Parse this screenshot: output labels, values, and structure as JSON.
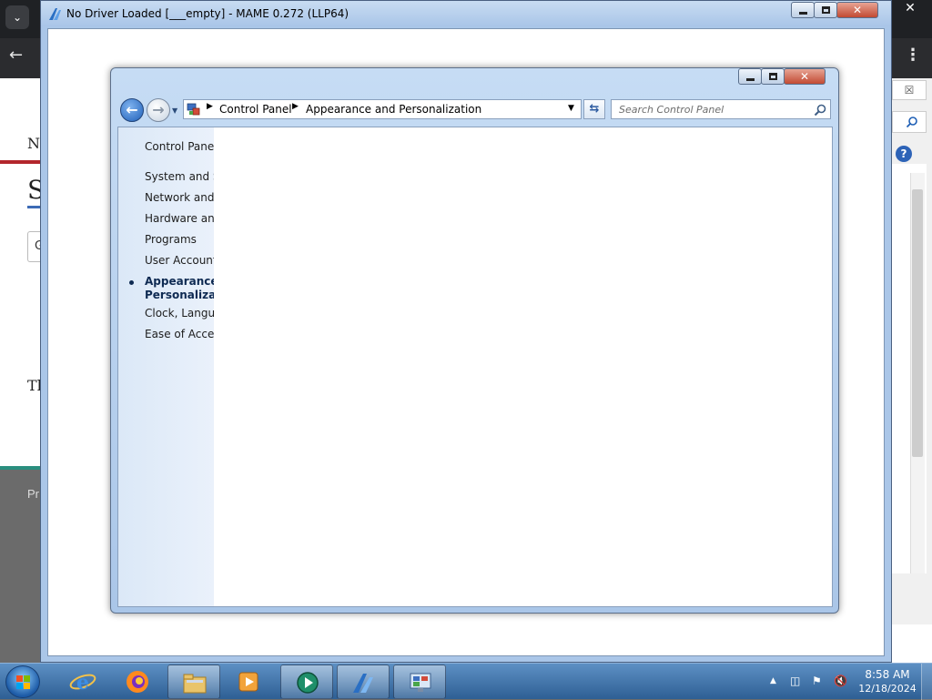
{
  "mame": {
    "title": "No Driver Loaded [___empty] - MAME 0.272 (LLP64)"
  },
  "control_panel": {
    "breadcrumb": [
      "Control Panel",
      "Appearance and Personalization"
    ],
    "search_placeholder": "Search Control Panel",
    "sidebar": [
      {
        "label": "Control Panel"
      },
      {
        "label": "System and Se"
      },
      {
        "label": "Network and I"
      },
      {
        "label": "Hardware and"
      },
      {
        "label": "Programs"
      },
      {
        "label": "User Accounts"
      },
      {
        "label": "Appearance a",
        "label2": "Personalizatio",
        "active": true
      },
      {
        "label": "Clock, Langua"
      },
      {
        "label": "Ease of Access"
      }
    ]
  },
  "background_page": {
    "text_n": "N",
    "text_s": "S",
    "text_g": "G",
    "text_th": "Th",
    "text_pr": "Pr"
  },
  "taskbar": {
    "time": "8:58 AM",
    "date": "12/18/2024"
  },
  "colors": {
    "taskbar": "#2e5f94",
    "window_frame": "#aac6e8",
    "sidebar": "#dbe8f7",
    "close_button": "#c24a32"
  }
}
